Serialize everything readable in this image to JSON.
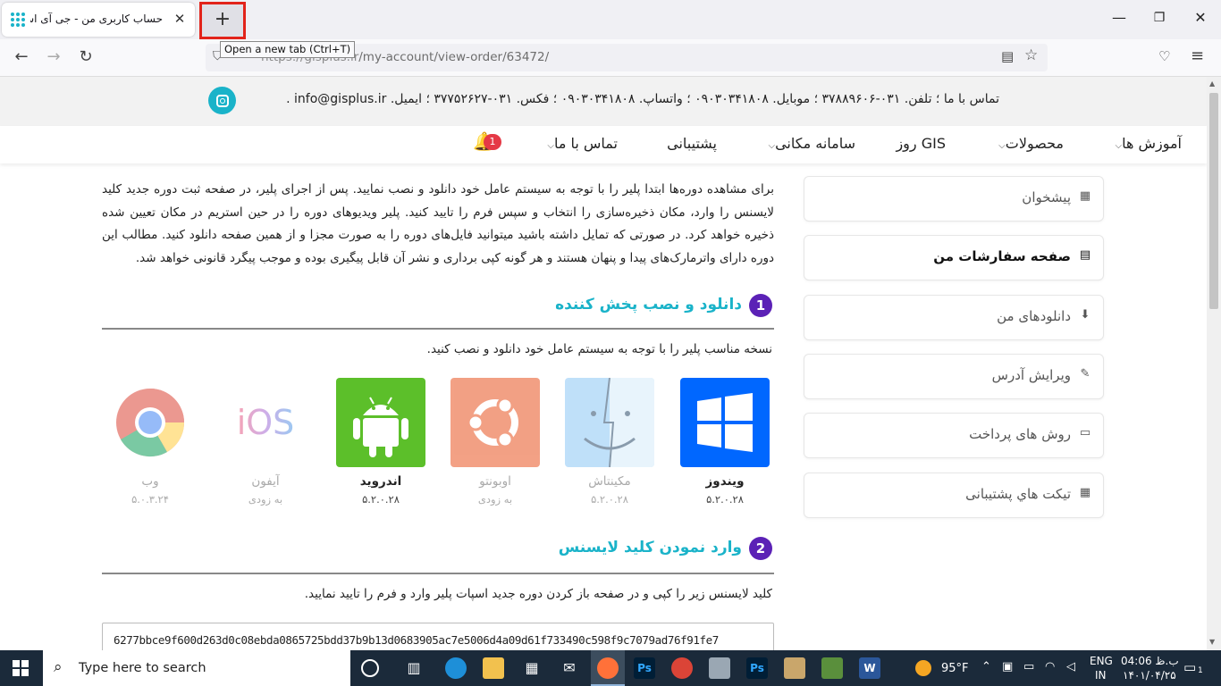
{
  "browser": {
    "tab_title": "حساب کاربری من - جی آی اس پلاس",
    "tab_close": "✕",
    "newtab_label": "+",
    "tooltip": "Open a new tab (Ctrl+T)",
    "url_prefix": "https://gisplus.ir",
    "url_path": "/my-account/view-order/63472/",
    "win_min": "—",
    "win_max": "❐",
    "win_close": "✕"
  },
  "site": {
    "contact": "تماس با ما ؛ تلفن. ۰۳۱-۳۷۸۸۹۶۰۶ ؛ موبایل. ۰۹۰۳۰۳۴۱۸۰۸ ؛ واتساپ. ۰۹۰۳۰۳۴۱۸۰۸ ؛ فکس. ۰۳۱-۳۷۷۵۲۶۲۷ ؛ ایمیل. info@gisplus.ir .",
    "nav": {
      "tutorials": "آموزش ها",
      "products": "محصولات",
      "spatial": "سامانه مکانی",
      "gis_day": "روز GIS",
      "support": "پشتیبانی",
      "contact": "تماس با ما",
      "notif_count": "1"
    },
    "sidebar": {
      "dashboard": "پیشخوان",
      "orders": "صفحه سفارشات من",
      "downloads": "دانلودهای من",
      "address": "ویرایش آدرس",
      "payment": "روش های پرداخت",
      "tickets": "تیکت هاي پشتیبانی"
    },
    "intro": "برای مشاهده دوره‌ها ابتدا پلیر را با توجه به سیستم عامل خود دانلود و نصب نمایید. پس از اجرای پلیر، در صفحه ثبت دوره جدید کلید لایسنس را وارد، مکان ذخیره‌سازی را انتخاب و سپس فرم را تایید کنید. پلیر ویدیوهای دوره را در حین استریم در مکان تعیین شده ذخیره خواهد کرد. در صورتی که تمایل داشته باشید میتوانید فایل‌های دوره را به صورت مجزا و از همین صفحه دانلود کنید. مطالب این دوره دارای واترمارک‌های پیدا و پنهان هستند و هر گونه کپی برداری و نشر آن قابل پیگیری بوده و موجب پیگرد قانونی خواهد شد.",
    "step1": {
      "num": "1",
      "title": "دانلود و نصب پخش کننده",
      "desc": "نسخه مناسب پلیر را با توجه به سیستم عامل خود دانلود و نصب کنید."
    },
    "platforms": [
      {
        "name": "ویندوز",
        "version": "۵.۲.۰.۲۸"
      },
      {
        "name": "مکینتاش",
        "version": "۵.۲.۰.۲۸"
      },
      {
        "name": "اوبونتو",
        "version": "به زودی"
      },
      {
        "name": "اندروید",
        "version": "۵.۲.۰.۲۸"
      },
      {
        "name": "آیفون",
        "version": "به زودی"
      },
      {
        "name": "وب",
        "version": "۵.۰.۳.۲۴"
      }
    ],
    "ios_text": "iOS",
    "step2": {
      "num": "2",
      "title": "وارد نمودن کلید لایسنس",
      "desc": "کلید لایسنس زیر را کپی و در صفحه باز کردن دوره جدید اسپات پلیر وارد و فرم را تایید نمایید."
    },
    "license_key": "6277bbce9f600d263d0c08ebda0865725bdd37b9b13d0683905ac7e5006d4a09d61f733490c598f9c7079ad76f91fe7"
  },
  "taskbar": {
    "search_placeholder": "Type here to search",
    "weather": "95°F",
    "lang_top": "ENG",
    "lang_bottom": "IN",
    "time": "ب.ظ 04:06",
    "date": "۱۴۰۱/۰۴/۲۵",
    "notif": "1"
  }
}
